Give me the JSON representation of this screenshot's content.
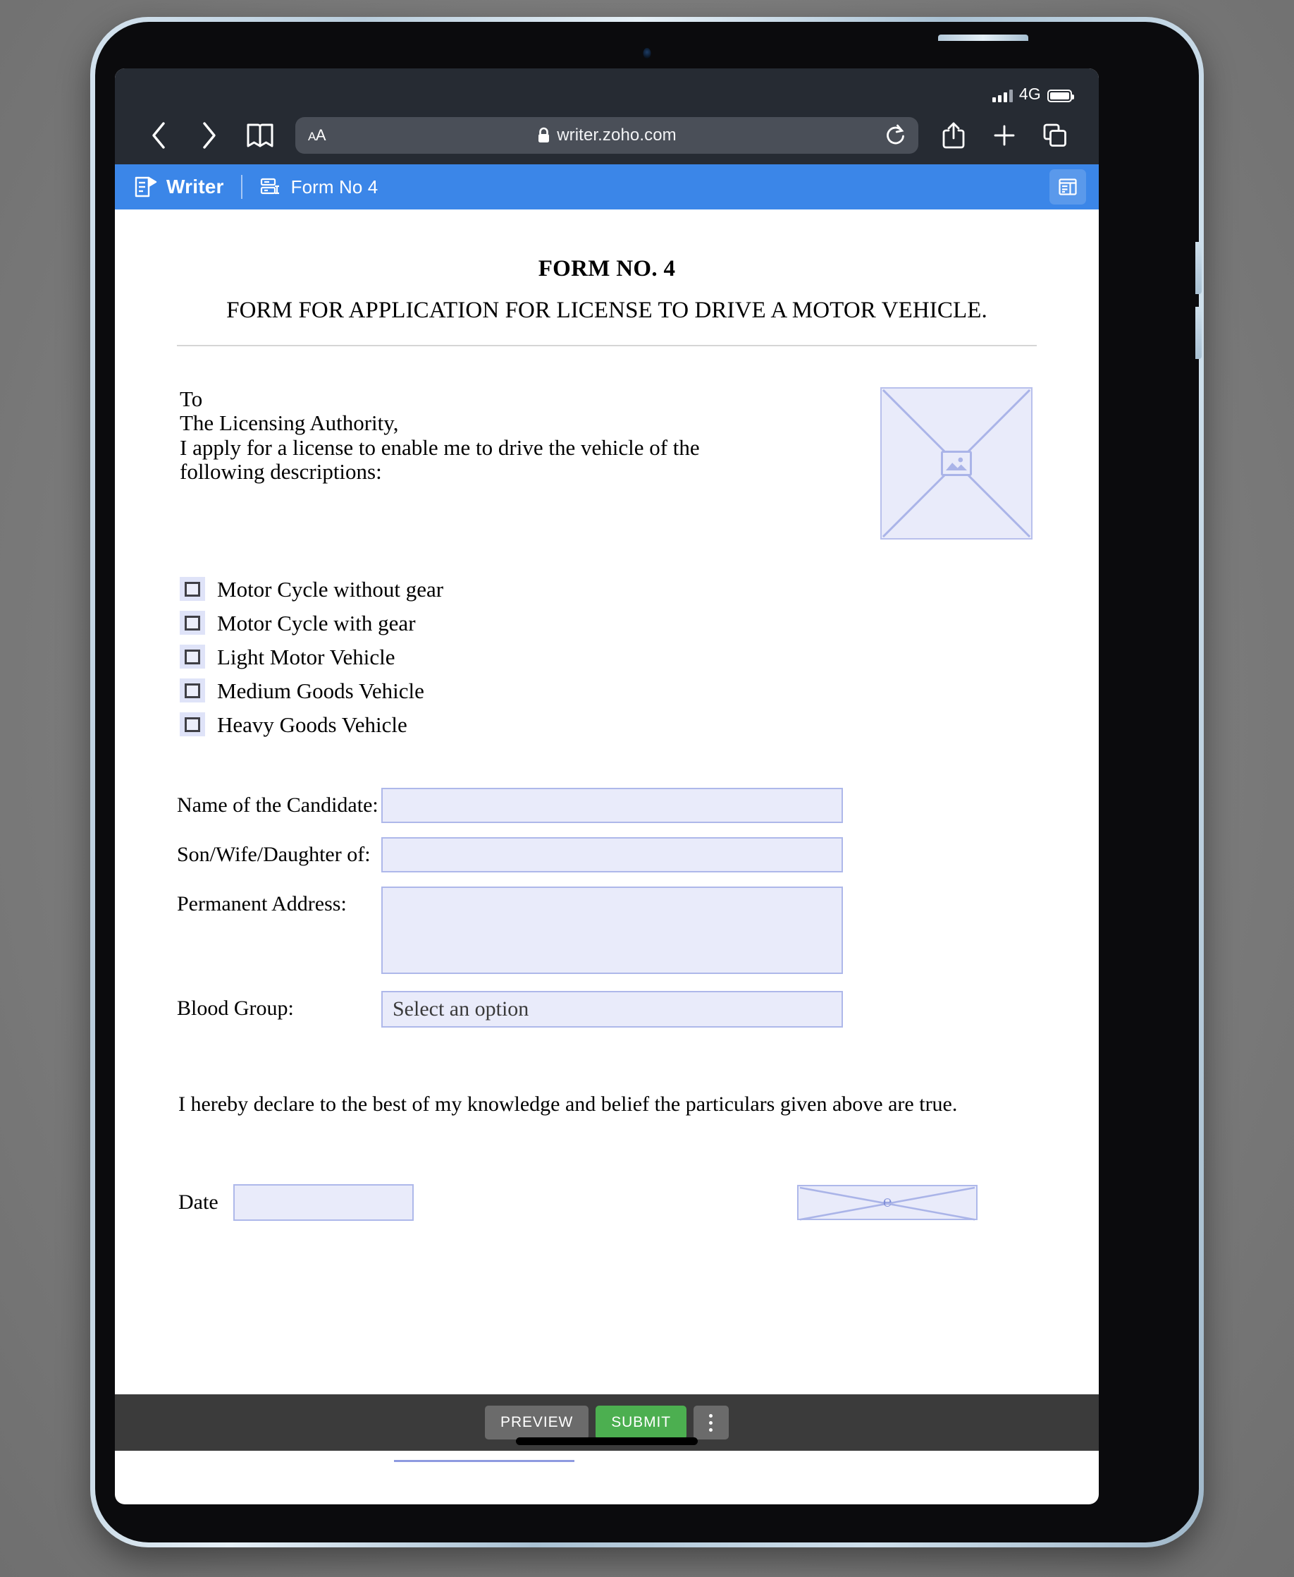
{
  "device": {
    "status_bar": {
      "network_label": "4G",
      "signal_icon": "signal-bars-icon",
      "battery_icon": "battery-icon"
    }
  },
  "browser": {
    "back_icon": "chevron-left-icon",
    "forward_icon": "chevron-right-icon",
    "bookmarks_icon": "book-icon",
    "text_size_label": "AA",
    "lock_icon": "lock-icon",
    "url": "writer.zoho.com",
    "reload_icon": "reload-icon",
    "share_icon": "share-icon",
    "new_tab_icon": "plus-icon",
    "tabs_icon": "tabs-icon"
  },
  "app_header": {
    "logo_icon": "writer-document-icon",
    "app_name": "Writer",
    "doc_icon": "form-layout-icon",
    "doc_title": "Form No 4",
    "panel_icon": "panel-layout-icon",
    "accent_color": "#3b86e8"
  },
  "document": {
    "title": "FORM NO. 4",
    "subtitle": "FORM FOR APPLICATION FOR LICENSE TO DRIVE A MOTOR VEHICLE.",
    "address_lines": [
      "To",
      "The Licensing Authority,",
      "I apply for a license to enable me to drive the vehicle of the",
      "following descriptions:"
    ],
    "photo_placeholder_icon": "image-placeholder-icon",
    "checkboxes": [
      {
        "label": "Motor Cycle without gear",
        "checked": false
      },
      {
        "label": "Motor Cycle with gear",
        "checked": false
      },
      {
        "label": "Light Motor Vehicle",
        "checked": false
      },
      {
        "label": "Medium Goods Vehicle",
        "checked": false
      },
      {
        "label": "Heavy Goods Vehicle",
        "checked": false
      }
    ],
    "fields": [
      {
        "label": "Name of the Candidate:",
        "value": "",
        "type": "text"
      },
      {
        "label": "Son/Wife/Daughter of:",
        "value": "",
        "type": "text"
      },
      {
        "label": "Permanent Address:",
        "value": "",
        "type": "textarea"
      }
    ],
    "blood_group": {
      "label": "Blood Group:",
      "selected": "Select an option"
    },
    "declaration": "I hereby declare to the best of my knowledge and belief the particulars given above are true.",
    "date": {
      "label": "Date",
      "value": ""
    },
    "signature": {
      "placeholder_icon": "signature-icon",
      "glyph": "℮"
    },
    "field_fill_color": "#e9ebfa",
    "field_border_color": "#aeb8ea"
  },
  "bottom_toolbar": {
    "preview_label": "PREVIEW",
    "submit_label": "SUBMIT",
    "more_icon": "more-vertical-icon",
    "submit_color": "#4caf50"
  }
}
